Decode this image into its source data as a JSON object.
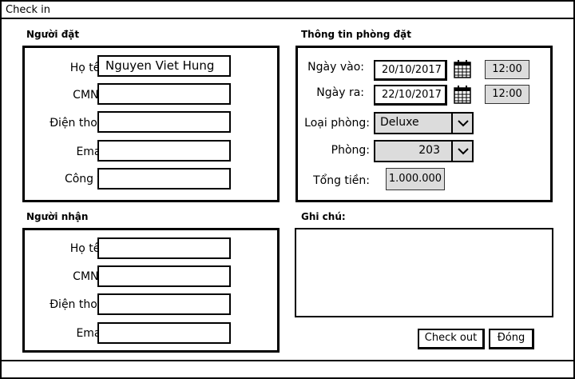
{
  "window": {
    "title": "Check in"
  },
  "booker": {
    "title": "Người đặt",
    "fields": [
      {
        "label": "Họ tên:",
        "value": "Nguyen Viet Hung"
      },
      {
        "label": "CMND:",
        "value": ""
      },
      {
        "label": "Điện thoại:",
        "value": ""
      },
      {
        "label": "Email:",
        "value": ""
      },
      {
        "label": "Công ty:",
        "value": ""
      }
    ]
  },
  "booking": {
    "title": "Thông tin phòng đặt",
    "checkin": {
      "label": "Ngày vào:",
      "date": "20/10/2017",
      "time": "12:00"
    },
    "checkout": {
      "label": "Ngày ra:",
      "date": "22/10/2017",
      "time": "12:00"
    },
    "room_type": {
      "label": "Loại phòng:",
      "value": "Deluxe"
    },
    "room": {
      "label": "Phòng:",
      "value": "203"
    },
    "total": {
      "label": "Tổng tiền:",
      "value": "1.000.000"
    }
  },
  "receiver": {
    "title": "Người nhận",
    "fields": [
      {
        "label": "Họ tên:",
        "value": ""
      },
      {
        "label": "CMND:",
        "value": ""
      },
      {
        "label": "Điện thoại:",
        "value": ""
      },
      {
        "label": "Email:",
        "value": ""
      }
    ]
  },
  "notes": {
    "title": "Ghi chú:",
    "value": ""
  },
  "actions": {
    "checkout_label": "Check out",
    "close_label": "Đóng"
  },
  "icons": {
    "calendar": "calendar-icon",
    "dropdown": "chevron-down-icon"
  },
  "colors": {
    "field_gray": "#dcdcdc",
    "border": "#000000"
  }
}
